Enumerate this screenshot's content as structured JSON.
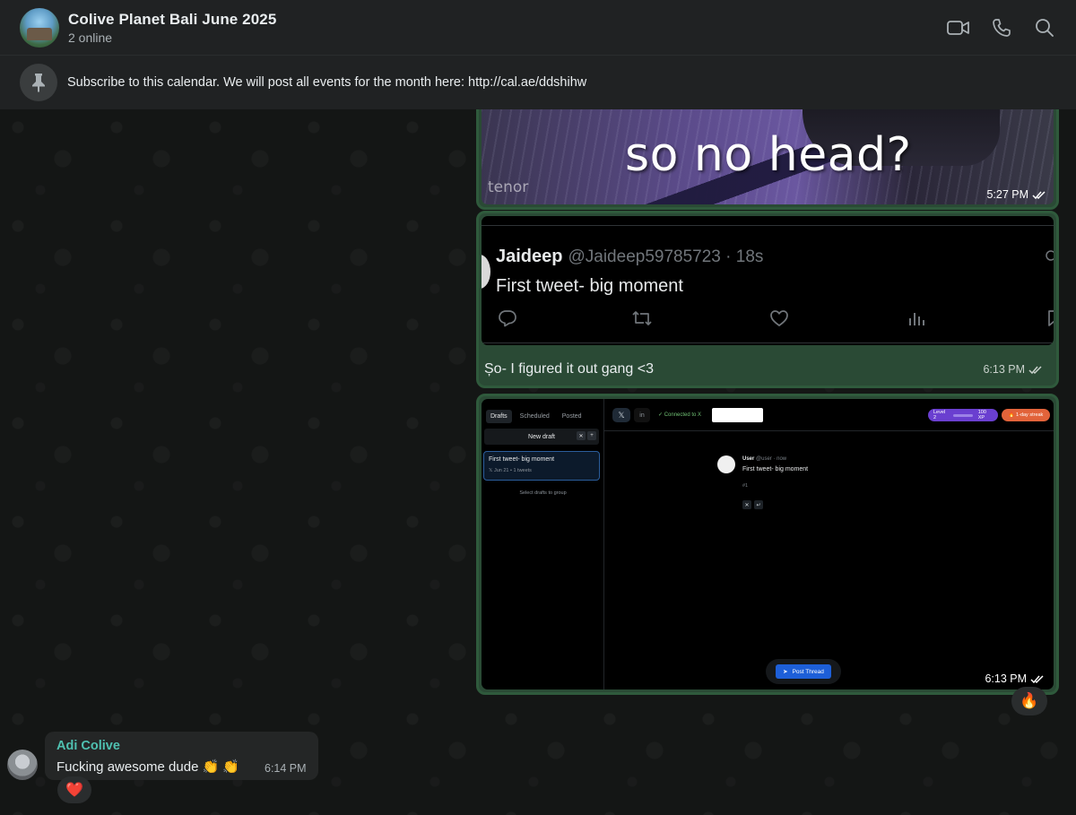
{
  "header": {
    "title": "Colive Planet Bali June 2025",
    "subtitle": "2 online"
  },
  "pinned": {
    "text": "Subscribe to this calendar. We will post all events for the month here: http://cal.ae/ddshihw"
  },
  "messages": {
    "gif": {
      "caption": "so no head?",
      "watermark": "tenor",
      "time": "5:27 PM"
    },
    "tweet": {
      "name": "Jaideep",
      "handle": "@Jaideep59785723 · 18s",
      "body": "First tweet- big moment",
      "caption": "Șo- I figured it out gang <3",
      "time": "6:13 PM"
    },
    "screenshot": {
      "tabs": [
        "Drafts",
        "Scheduled",
        "Posted"
      ],
      "new_draft": "New draft",
      "draft_title": "First tweet- big moment",
      "draft_meta": "𝕏 Jun 21 • 1 tweets",
      "hint": "Select drafts to group",
      "connected": "✓ Connected to X",
      "level": "Level 2",
      "xp": "100 XP",
      "streak": "🔥 1-day streak",
      "post_user": "User",
      "post_handle": "@user · now",
      "post_text": "First tweet- big moment",
      "post_num": "#1",
      "post_button": "Post Thread",
      "time": "6:13 PM"
    },
    "reaction_out": "🔥",
    "incoming": {
      "sender": "Adi Colive",
      "text": "Fucking awesome dude 👏 👏",
      "time": "6:14 PM",
      "reaction": "❤️"
    }
  },
  "icons": {
    "video": "video-call-icon",
    "phone": "voice-call-icon",
    "search": "search-icon",
    "pin": "pin-icon",
    "ticks": "double-check-icon"
  },
  "colors": {
    "outgoing_bubble": "#2a4a35",
    "incoming_sender": "#4fc0b0",
    "header_bg": "#202223"
  }
}
